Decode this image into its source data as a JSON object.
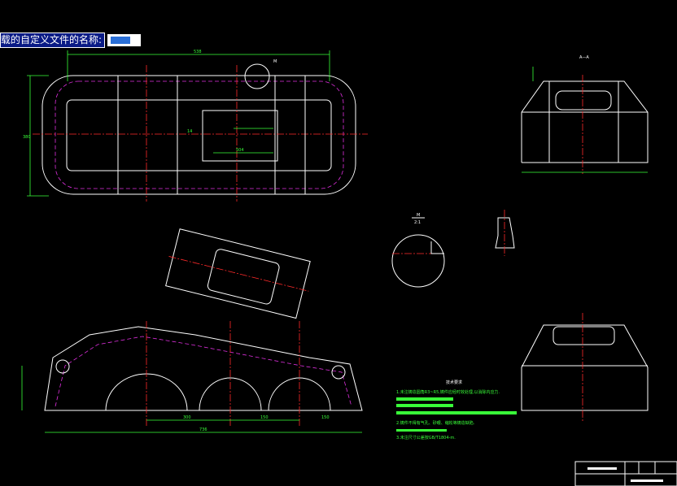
{
  "prompt": {
    "label": "载的自定义文件的名称:",
    "input_value": ""
  },
  "drawing": {
    "main_view_dims": {
      "width_top": "538",
      "height_left": "380",
      "inner": "504",
      "center": "14"
    },
    "side_view_label": "A—A",
    "detail_label": "M",
    "detail_scale": "2:1",
    "bottom_dims": [
      "300",
      "150",
      "150",
      "736"
    ],
    "notes_title": "技术要求",
    "notes": [
      "1.未注铸造圆角R3~R5,铸件应经时效处理,以消除内应力.",
      "2.铸件不得有气孔、砂眼、缩松等铸造缺陷.",
      "3.未注尺寸公差按GB/T1804-m.",
      "4.非加工表面涂底漆."
    ]
  },
  "colors": {
    "background": "#000000",
    "outline": "#ffffff",
    "dimension": "#39ff39",
    "centerline": "#ff2a2a",
    "hidden": "#e030e0",
    "prompt_bg": "#0a1b86"
  }
}
